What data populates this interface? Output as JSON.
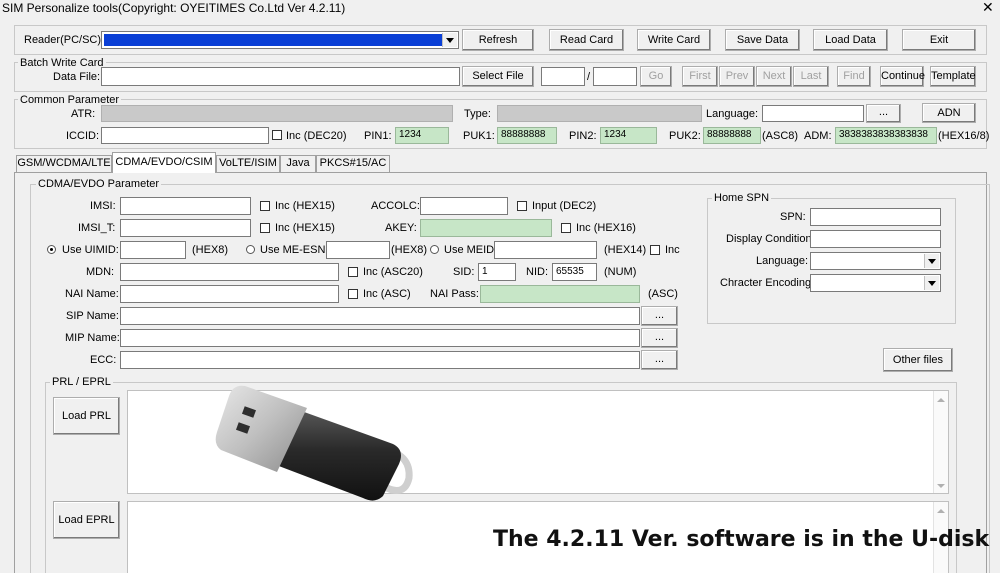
{
  "window": {
    "title": "SIM Personalize tools(Copyright: OYEITIMES Co.Ltd  Ver 4.2.11)",
    "close": "✕"
  },
  "reader": {
    "label": "Reader(PC/SC):"
  },
  "toolbar": {
    "refresh": "Refresh",
    "read_card": "Read Card",
    "write_card": "Write Card",
    "save_data": "Save Data",
    "load_data": "Load Data",
    "exit": "Exit"
  },
  "batch": {
    "title": "Batch Write Card",
    "data_file_label": "Data File:",
    "select_file": "Select File",
    "slash": "/",
    "go": "Go",
    "first": "First",
    "prev": "Prev",
    "next": "Next",
    "last": "Last",
    "find": "Find",
    "continue": "Continue",
    "template": "Template"
  },
  "common": {
    "title": "Common Parameter",
    "atr_label": "ATR:",
    "type_label": "Type:",
    "language_label": "Language:",
    "lang_btn": "...",
    "adn": "ADN",
    "iccid_label": "ICCID:",
    "inc_dec20": "Inc  (DEC20)",
    "pin1_label": "PIN1:",
    "pin1": "1234",
    "puk1_label": "PUK1:",
    "puk1": "88888888",
    "pin2_label": "PIN2:",
    "pin2": "1234",
    "puk2_label": "PUK2:",
    "puk2": "88888888",
    "asc8": "(ASC8)",
    "adm_label": "ADM:",
    "adm": "3838383838383838",
    "hex168": "(HEX16/8)"
  },
  "tabs": [
    "GSM/WCDMA/LTE",
    "CDMA/EVDO/CSIM",
    "VoLTE/ISIM",
    "Java",
    "PKCS#15/AC"
  ],
  "cdma": {
    "title": "CDMA/EVDO Parameter",
    "imsi_label": "IMSI:",
    "inc_hex15": "Inc  (HEX15)",
    "accolc_label": "ACCOLC:",
    "input_dec2": "Input  (DEC2)",
    "imsi_t_label": "IMSI_T:",
    "inc_hex15_2": "Inc  (HEX15)",
    "akey_label": "AKEY:",
    "inc_hex16": "Inc  (HEX16)",
    "use_uimid": "Use UIMID:",
    "hex8": "(HEX8)",
    "use_me_esn": "Use ME-ESN:",
    "hex8_2": "(HEX8)",
    "use_meid": "Use MEID:",
    "hex14": "(HEX14)",
    "inc": "Inc",
    "mdn_label": "MDN:",
    "inc_asc20": "Inc  (ASC20)",
    "sid_label": "SID:",
    "sid": "1",
    "nid_label": "NID:",
    "nid": "65535",
    "num": "(NUM)",
    "nai_name_label": "NAI Name:",
    "inc_asc": "Inc  (ASC)",
    "nai_pass_label": "NAI Pass:",
    "asc": "(ASC)",
    "sip_label": "SIP Name:",
    "mip_label": "MIP Name:",
    "ecc_label": "ECC:",
    "dots": "..."
  },
  "spn": {
    "title": "Home SPN",
    "spn_label": "SPN:",
    "display_label": "Display Condition:",
    "language_label": "Language:",
    "encoding_label": "Chracter Encoding:",
    "other_files": "Other files"
  },
  "prl": {
    "title": "PRL / EPRL",
    "load_prl": "Load PRL",
    "load_eprl": "Load EPRL"
  },
  "overlay": {
    "caption": "The 4.2.11 Ver. software is in the U-disk"
  }
}
